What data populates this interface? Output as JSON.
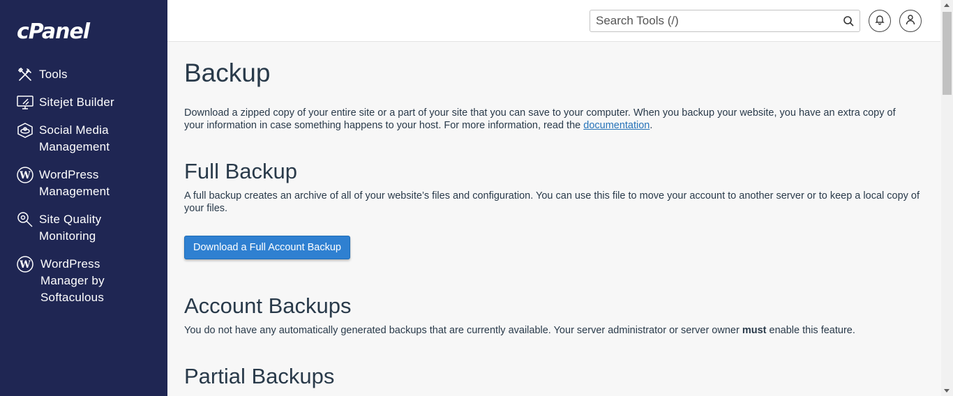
{
  "sidebar": {
    "logo": "cPanel",
    "items": [
      {
        "label": "Tools",
        "icon": "tools-icon"
      },
      {
        "label": "Sitejet Builder",
        "icon": "monitor-icon"
      },
      {
        "label": "Social Media Management",
        "icon": "social-media-icon"
      },
      {
        "label": "WordPress Management",
        "icon": "wordpress-icon"
      },
      {
        "label": "Site Quality Monitoring",
        "icon": "magnifier-gear-icon"
      },
      {
        "label": "WordPress Manager by Softaculous",
        "icon": "wordpress-icon"
      }
    ]
  },
  "header": {
    "search_placeholder": "Search Tools (/)",
    "search_icon": "search-icon",
    "notifications_icon": "bell-icon",
    "user_icon": "user-icon"
  },
  "main": {
    "title": "Backup",
    "intro_text": "Download a zipped copy of your entire site or a part of your site that you can save to your computer. When you backup your website, you have an extra copy of your information in case something happens to your host. For more information, read the ",
    "intro_link": "documentation",
    "intro_end": ".",
    "full_backup": {
      "heading": "Full Backup",
      "description": "A full backup creates an archive of all of your website’s files and configuration. You can use this file to move your account to another server or to keep a local copy of your files.",
      "button_label": "Download a Full Account Backup"
    },
    "account_backups": {
      "heading": "Account Backups",
      "text_before": "You do not have any automatically generated backups that are currently available. Your server administrator or server owner ",
      "text_bold": "must",
      "text_after": " enable this feature."
    },
    "partial_backups": {
      "heading": "Partial Backups"
    }
  },
  "colors": {
    "sidebar_bg": "#1f2653",
    "accent": "#2f80d1",
    "link": "#2572b8",
    "text": "#293a4a"
  }
}
